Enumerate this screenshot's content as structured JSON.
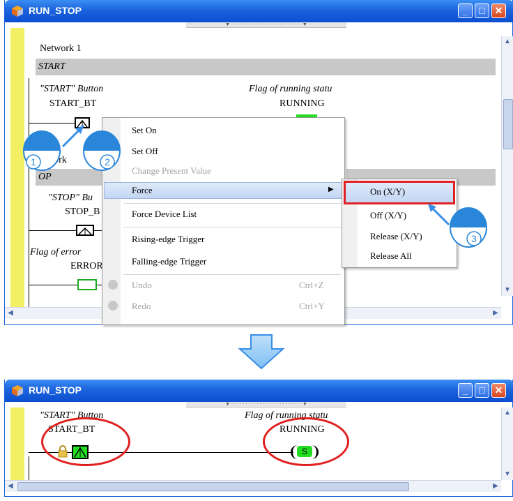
{
  "window1": {
    "title": "RUN_STOP",
    "network1_label": "Network 1",
    "network1_header": "START",
    "start_comment": "\"START\" Button",
    "start_device": "START_BT",
    "running_comment": "Flag of running statu",
    "running_device": "RUNNING",
    "network2_label_fragment": "work",
    "network2_header_fragment": "OP",
    "stop_comment_fragment": "\"STOP\" Bu",
    "stop_device_fragment": "STOP_B",
    "error_comment_fragment": "Flag of error",
    "error_device_fragment": "ERROR"
  },
  "context_menu": {
    "items": [
      {
        "label": "Set On",
        "enabled": true
      },
      {
        "label": "Set Off",
        "enabled": true
      },
      {
        "label": "Change Present Value",
        "enabled": false
      },
      {
        "label": "Force",
        "enabled": true,
        "submenu": true
      },
      {
        "label": "Force Device List",
        "enabled": true
      },
      {
        "label": "Rising-edge Trigger",
        "enabled": true
      },
      {
        "label": "Falling-edge Trigger",
        "enabled": true
      },
      {
        "label": "Undo",
        "shortcut": "Ctrl+Z",
        "enabled": false
      },
      {
        "label": "Redo",
        "shortcut": "Ctrl+Y",
        "enabled": false
      }
    ]
  },
  "submenu": {
    "items": [
      {
        "label": "On (X/Y)"
      },
      {
        "label": "Off (X/Y)"
      },
      {
        "label": "Release (X/Y)"
      },
      {
        "label": "Release All"
      }
    ]
  },
  "steps": [
    "1",
    "2",
    "3"
  ],
  "window2": {
    "title": "RUN_STOP",
    "start_comment": "\"START\" Button",
    "start_device": "START_BT",
    "running_comment": "Flag of running statu",
    "running_device": "RUNNING",
    "coil_letter": "S"
  },
  "colors": {
    "title_blue": "#1c63dd",
    "header_gray": "#c8c8c8",
    "yellow_bar": "#f2ef64",
    "active_green": "#22dd22",
    "highlight_red": "#e02020",
    "arrow_blue": "#3a8ee6"
  }
}
